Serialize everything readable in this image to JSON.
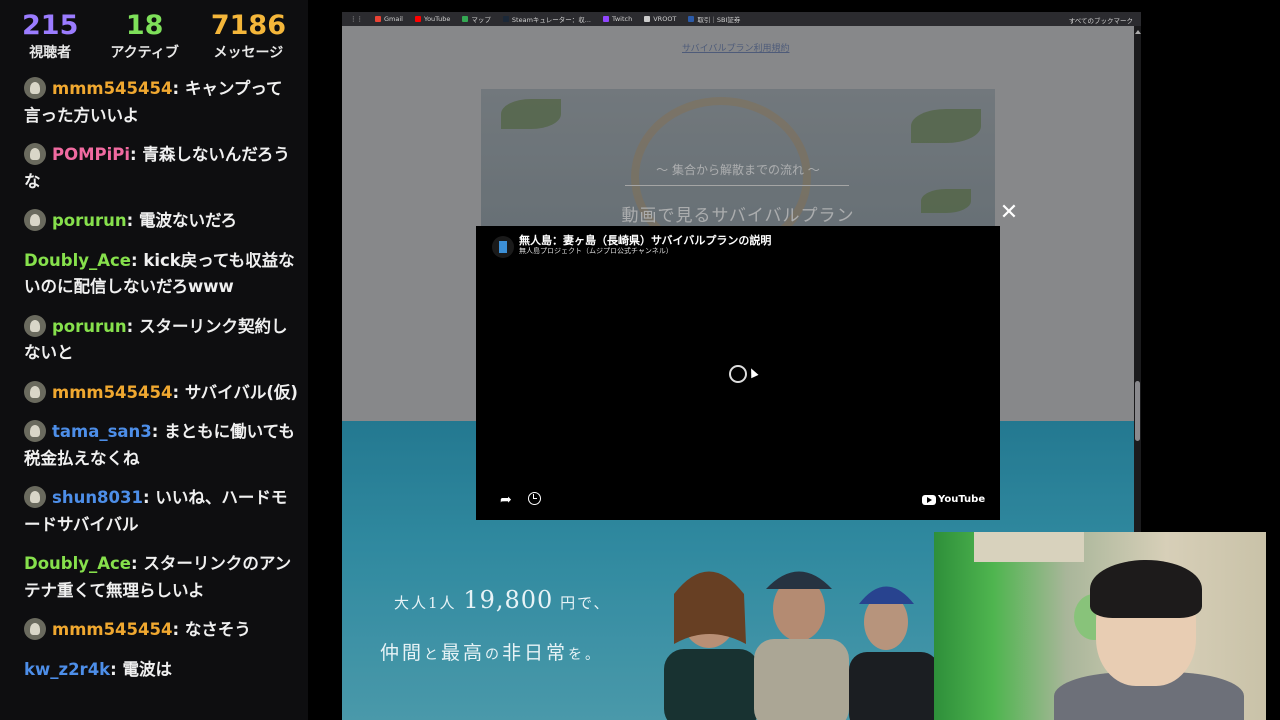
{
  "stats": [
    {
      "value": "215",
      "label": "視聴者",
      "color": "#9b7cff"
    },
    {
      "value": "18",
      "label": "アクティブ",
      "color": "#7ee05a"
    },
    {
      "value": "7186",
      "label": "メッセージ",
      "color": "#f4b63a"
    }
  ],
  "chat": [
    {
      "user": "mmm545454",
      "color": "#f0a830",
      "avatar": true,
      "text": "キャンプって言った方いいよ"
    },
    {
      "user": "POMPiPi",
      "color": "#f06aa0",
      "avatar": true,
      "text": "青森しないんだろうな"
    },
    {
      "user": "porurun",
      "color": "#86e04c",
      "avatar": true,
      "text": "電波ないだろ"
    },
    {
      "user": "Doubly_Ace",
      "color": "#86e04c",
      "avatar": false,
      "text": "kick戻っても収益ないのに配信しないだろwww"
    },
    {
      "user": "porurun",
      "color": "#86e04c",
      "avatar": true,
      "text": "スターリンク契約しないと"
    },
    {
      "user": "mmm545454",
      "color": "#f0a830",
      "avatar": true,
      "text": "サバイバル(仮)"
    },
    {
      "user": "tama_san3",
      "color": "#4d8ee8",
      "avatar": true,
      "text": "まともに働いても税金払えなくね"
    },
    {
      "user": "shun8031",
      "color": "#4d8ee8",
      "avatar": true,
      "text": "いいね、ハードモードサバイバル"
    },
    {
      "user": "Doubly_Ace",
      "color": "#86e04c",
      "avatar": false,
      "text": "スターリンクのアンテナ重くて無理らしいよ"
    },
    {
      "user": "mmm545454",
      "color": "#f0a830",
      "avatar": true,
      "text": "なさそう"
    },
    {
      "user": "kw_z2r4k",
      "color": "#4d8ee8",
      "avatar": false,
      "text": "電波は"
    }
  ],
  "browser": {
    "bookmarks": [
      {
        "label": "Gmail",
        "color": "#ea4335"
      },
      {
        "label": "YouTube",
        "color": "#ff0000"
      },
      {
        "label": "マップ",
        "color": "#34a853"
      },
      {
        "label": "Steamキュレーター：収...",
        "color": "#1b2838"
      },
      {
        "label": "Twitch",
        "color": "#9146ff"
      },
      {
        "label": "VROOT",
        "color": "#cccccc"
      },
      {
        "label": "取引｜SBI証券",
        "color": "#2b5aa8"
      }
    ],
    "all_bookmarks": "すべてのブックマーク",
    "link_top": "サバイバルプラン利用規約",
    "hero_sub": "〜 集合から解散までの流れ 〜",
    "hero_title": "動画で見るサバイバルプラン",
    "promo_1a": "大人1人 ",
    "promo_1b": "19,800",
    "promo_1c": " 円で、",
    "promo_2a": "仲間",
    "promo_2b": "と",
    "promo_2c": "最高",
    "promo_2d": "の",
    "promo_2e": "非日常",
    "promo_2f": "を。"
  },
  "video": {
    "title": "無人島：妻ヶ島（長崎県）サバイバルプランの説明",
    "channel": "無人島プロジェクト（ムジプロ公式チャンネル）",
    "brand": "YouTube",
    "close_icon": "close-icon",
    "share_icon": "share-icon",
    "watch_later_icon": "clock-icon"
  }
}
